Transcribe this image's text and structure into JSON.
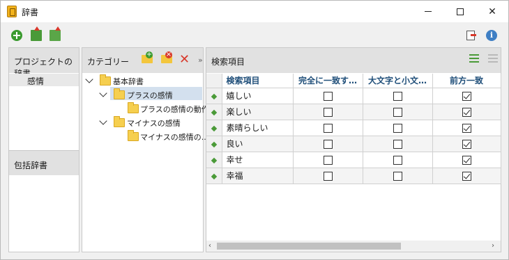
{
  "window": {
    "title": "辞書",
    "icon": "dictionary-book-icon"
  },
  "toolbar": {
    "add": "add-icon",
    "export": "export-icon",
    "import": "import-icon",
    "exit": "exit-icon",
    "info": "i"
  },
  "left_panel": {
    "project_header": "プロジェクトの辞書",
    "project_items": [
      "感情"
    ],
    "global_header": "包括辞書"
  },
  "category_panel": {
    "header": "カテゴリー",
    "collapse_glyph": "»",
    "tree": [
      {
        "label": "基本辞書"
      },
      {
        "label": "プラスの感情"
      },
      {
        "label": "プラスの感情の動作"
      },
      {
        "label": "マイナスの感情"
      },
      {
        "label": "マイナスの感情の..."
      }
    ]
  },
  "search_panel": {
    "header": "検索項目",
    "columns": [
      "検索項目",
      "完全に一致す…",
      "大文字と小文…",
      "前方一致"
    ],
    "rows": [
      {
        "term": "嬉しい",
        "exact": false,
        "case": false,
        "prefix": true
      },
      {
        "term": "楽しい",
        "exact": false,
        "case": false,
        "prefix": true
      },
      {
        "term": "素晴らしい",
        "exact": false,
        "case": false,
        "prefix": true
      },
      {
        "term": "良い",
        "exact": false,
        "case": false,
        "prefix": true
      },
      {
        "term": "幸せ",
        "exact": false,
        "case": false,
        "prefix": true
      },
      {
        "term": "幸福",
        "exact": false,
        "case": false,
        "prefix": true
      }
    ]
  },
  "colors": {
    "accent_green": "#4a9a38",
    "header_blue": "#1f4e79",
    "delete_red": "#d8392b"
  }
}
